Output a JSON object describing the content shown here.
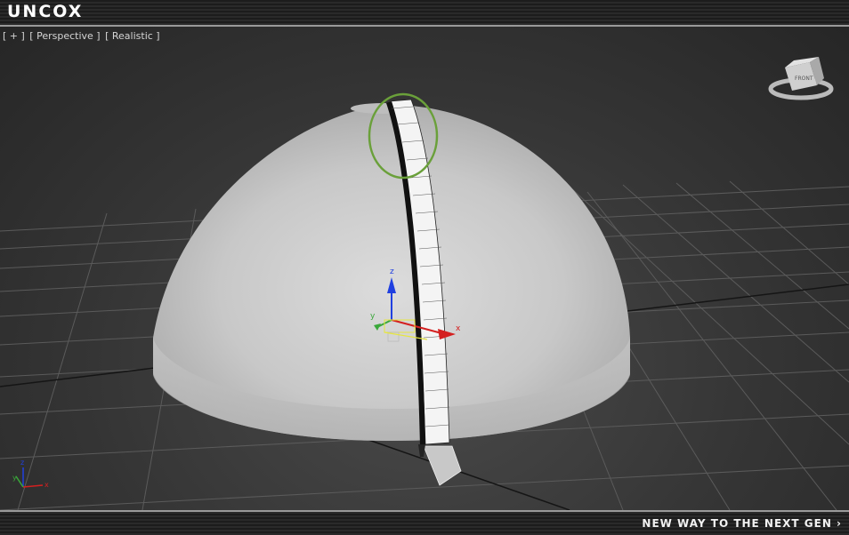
{
  "brand": {
    "logo_text": "UNCOX"
  },
  "viewport": {
    "menu_label": "[ + ]",
    "view_label": "[ Perspective ]",
    "shading_label": "[ Realistic ]",
    "viewcube_face": "FRONT",
    "gizmo_axes": {
      "x": "x",
      "y": "y",
      "z": "z"
    },
    "corner_axes": {
      "x": "x",
      "y": "y",
      "z": "z"
    }
  },
  "footer": {
    "tagline": "NEW WAY TO THE NEXT GEN ›"
  },
  "colors": {
    "highlight_ring": "#6aa03a",
    "axis_x": "#d42020",
    "axis_y": "#3aa83a",
    "axis_z": "#2040e0"
  }
}
